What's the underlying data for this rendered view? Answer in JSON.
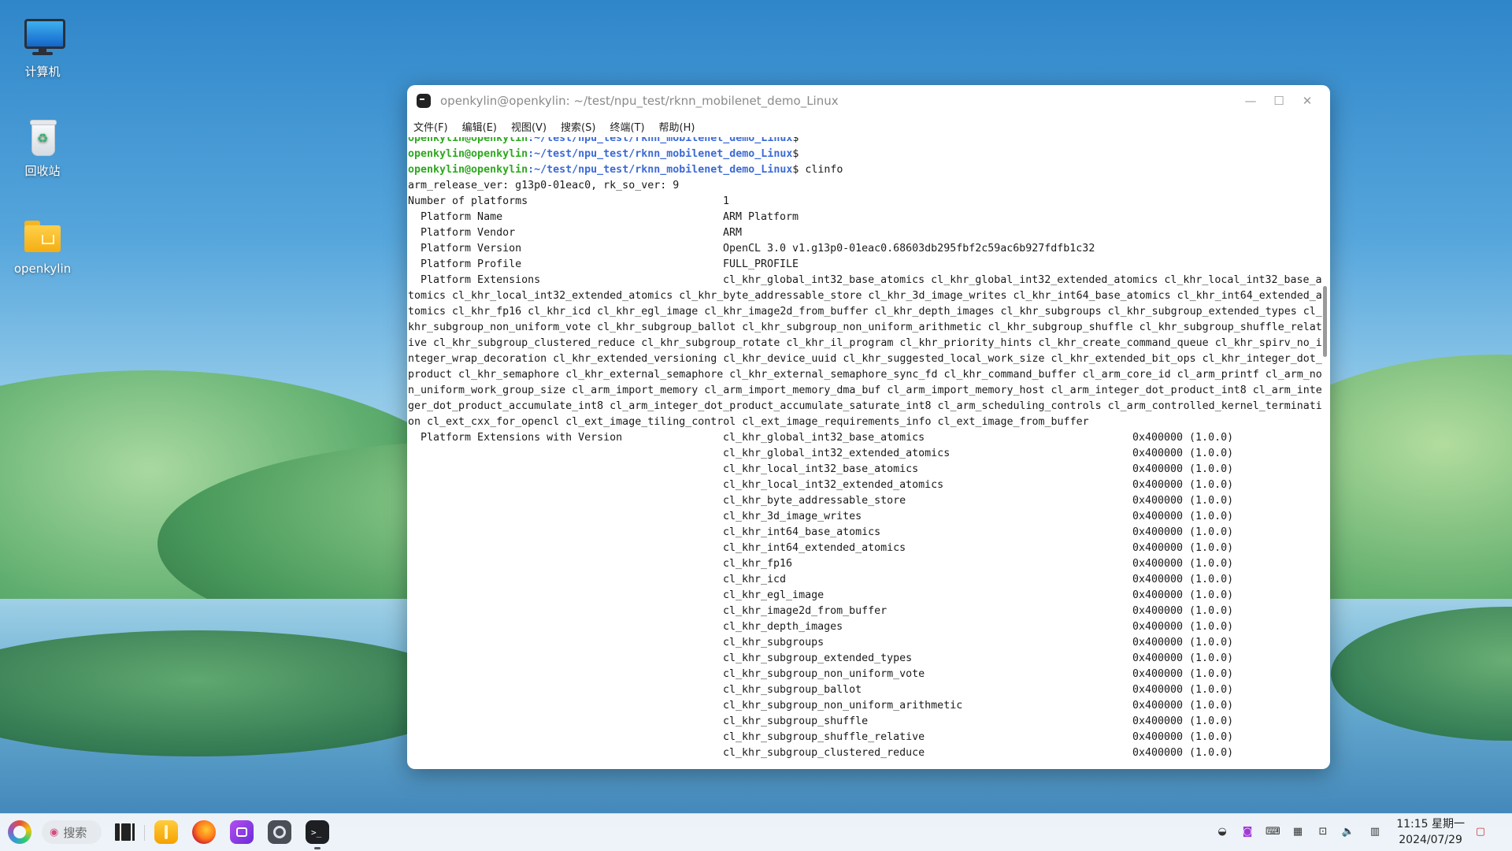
{
  "desktop": {
    "icons": [
      {
        "label": "计算机",
        "icon": "computer-icon"
      },
      {
        "label": "回收站",
        "icon": "recycle-bin-icon"
      },
      {
        "label": "openkylin",
        "icon": "folder-icon"
      }
    ]
  },
  "window": {
    "title": "openkylin@openkylin: ~/test/npu_test/rknn_mobilenet_demo_Linux",
    "menu": [
      "文件(F)",
      "编辑(E)",
      "视图(V)",
      "搜索(S)",
      "终端(T)",
      "帮助(H)"
    ]
  },
  "terminal": {
    "prompts": [
      {
        "user": "openkylin@openkylin",
        "path": ":~/test/npu_test/rknn_mobilenet_demo_Linux",
        "sym": "$",
        "cmd": ""
      },
      {
        "user": "openkylin@openkylin",
        "path": ":~/test/npu_test/rknn_mobilenet_demo_Linux",
        "sym": "$",
        "cmd": ""
      },
      {
        "user": "openkylin@openkylin",
        "path": ":~/test/npu_test/rknn_mobilenet_demo_Linux",
        "sym": "$",
        "cmd": " clinfo"
      }
    ],
    "release_line": "arm_release_ver: g13p0-01eac0, rk_so_ver: 9",
    "info_rows": [
      {
        "key": "Number of platforms",
        "value": "1"
      },
      {
        "key": "  Platform Name",
        "value": "ARM Platform"
      },
      {
        "key": "  Platform Vendor",
        "value": "ARM"
      },
      {
        "key": "  Platform Version",
        "value": "OpenCL 3.0 v1.g13p0-01eac0.68603db295fbf2c59ac6b927fdfb1c32"
      },
      {
        "key": "  Platform Profile",
        "value": "FULL_PROFILE"
      },
      {
        "key": "  Platform Extensions",
        "value": "cl_khr_global_int32_base_atomics cl_khr_global_int32_extended_atomics cl_khr_local_int32_base_a"
      }
    ],
    "wrapped_lines": [
      "tomics cl_khr_local_int32_extended_atomics cl_khr_byte_addressable_store cl_khr_3d_image_writes cl_khr_int64_base_atomics cl_khr_int64_extended_a",
      "tomics cl_khr_fp16 cl_khr_icd cl_khr_egl_image cl_khr_image2d_from_buffer cl_khr_depth_images cl_khr_subgroups cl_khr_subgroup_extended_types cl_",
      "khr_subgroup_non_uniform_vote cl_khr_subgroup_ballot cl_khr_subgroup_non_uniform_arithmetic cl_khr_subgroup_shuffle cl_khr_subgroup_shuffle_relat",
      "ive cl_khr_subgroup_clustered_reduce cl_khr_subgroup_rotate cl_khr_il_program cl_khr_priority_hints cl_khr_create_command_queue cl_khr_spirv_no_i",
      "nteger_wrap_decoration cl_khr_extended_versioning cl_khr_device_uuid cl_khr_suggested_local_work_size cl_khr_extended_bit_ops cl_khr_integer_dot_",
      "product cl_khr_semaphore cl_khr_external_semaphore cl_khr_external_semaphore_sync_fd cl_khr_command_buffer cl_arm_core_id cl_arm_printf cl_arm_no",
      "n_uniform_work_group_size cl_arm_import_memory cl_arm_import_memory_dma_buf cl_arm_import_memory_host cl_arm_integer_dot_product_int8 cl_arm_inte",
      "ger_dot_product_accumulate_int8 cl_arm_integer_dot_product_accumulate_saturate_int8 cl_arm_scheduling_controls cl_arm_controlled_kernel_terminati",
      "on cl_ext_cxx_for_opencl cl_ext_image_tiling_control cl_ext_image_requirements_info cl_ext_image_from_buffer"
    ],
    "ext_version_label": "  Platform Extensions with Version",
    "ext_versions": [
      {
        "name": "cl_khr_global_int32_base_atomics",
        "ver": "0x400000 (1.0.0)"
      },
      {
        "name": "cl_khr_global_int32_extended_atomics",
        "ver": "0x400000 (1.0.0)"
      },
      {
        "name": "cl_khr_local_int32_base_atomics",
        "ver": "0x400000 (1.0.0)"
      },
      {
        "name": "cl_khr_local_int32_extended_atomics",
        "ver": "0x400000 (1.0.0)"
      },
      {
        "name": "cl_khr_byte_addressable_store",
        "ver": "0x400000 (1.0.0)"
      },
      {
        "name": "cl_khr_3d_image_writes",
        "ver": "0x400000 (1.0.0)"
      },
      {
        "name": "cl_khr_int64_base_atomics",
        "ver": "0x400000 (1.0.0)"
      },
      {
        "name": "cl_khr_int64_extended_atomics",
        "ver": "0x400000 (1.0.0)"
      },
      {
        "name": "cl_khr_fp16",
        "ver": "0x400000 (1.0.0)"
      },
      {
        "name": "cl_khr_icd",
        "ver": "0x400000 (1.0.0)"
      },
      {
        "name": "cl_khr_egl_image",
        "ver": "0x400000 (1.0.0)"
      },
      {
        "name": "cl_khr_image2d_from_buffer",
        "ver": "0x400000 (1.0.0)"
      },
      {
        "name": "cl_khr_depth_images",
        "ver": "0x400000 (1.0.0)"
      },
      {
        "name": "cl_khr_subgroups",
        "ver": "0x400000 (1.0.0)"
      },
      {
        "name": "cl_khr_subgroup_extended_types",
        "ver": "0x400000 (1.0.0)"
      },
      {
        "name": "cl_khr_subgroup_non_uniform_vote",
        "ver": "0x400000 (1.0.0)"
      },
      {
        "name": "cl_khr_subgroup_ballot",
        "ver": "0x400000 (1.0.0)"
      },
      {
        "name": "cl_khr_subgroup_non_uniform_arithmetic",
        "ver": "0x400000 (1.0.0)"
      },
      {
        "name": "cl_khr_subgroup_shuffle",
        "ver": "0x400000 (1.0.0)"
      },
      {
        "name": "cl_khr_subgroup_shuffle_relative",
        "ver": "0x400000 (1.0.0)"
      },
      {
        "name": "cl_khr_subgroup_clustered_reduce",
        "ver": "0x400000 (1.0.0)"
      }
    ]
  },
  "taskbar": {
    "search_placeholder": "搜索",
    "apps": [
      "kylin-start-icon",
      "multitask-view-icon",
      "file-manager-icon",
      "firefox-icon",
      "screenshot-icon",
      "settings-icon",
      "terminal-icon"
    ],
    "tray": [
      "status-icon",
      "camera-icon",
      "keyboard-icon",
      "input-method-icon",
      "network-icon",
      "volume-icon",
      "storage-icon"
    ],
    "time": "11:15 星期一",
    "date": "2024/07/29"
  }
}
